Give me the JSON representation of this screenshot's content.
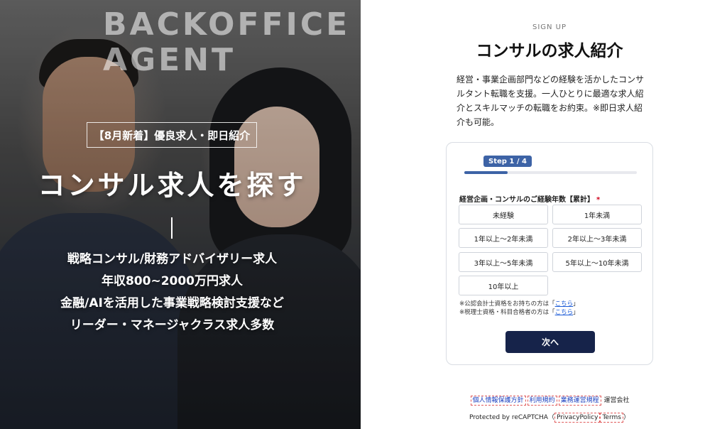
{
  "hero": {
    "brand_line1": "BACKOFFICE",
    "brand_line2": "AGENT",
    "badge": "【8月新着】優良求人・即日紹介",
    "title": "コンサル求人を探す",
    "lines": [
      "戦略コンサル/財務アドバイザリー求人",
      "年収800~2000万円求人",
      "金融/AIを活用した事業戦略検討支援など",
      "リーダー・マネージャクラス求人多数"
    ]
  },
  "signup": {
    "label": "SIGN UP",
    "title": "コンサルの求人紹介",
    "intro": "経営・事業企画部門などの経験を活かしたコンサルタント転職を支援。一人ひとりに最適な求人紹介とスキルマッチの転職をお約束。※即日求人紹介も可能。"
  },
  "form": {
    "step": "Step 1 / 4",
    "progress": 0.25,
    "question": "経営企画・コンサルのご経験年数【累計】",
    "required_mark": "*",
    "options": [
      "未経験",
      "1年未満",
      "1年以上〜2年未満",
      "2年以上〜3年未満",
      "3年以上〜5年未満",
      "5年以上〜10年未満",
      "10年以上"
    ],
    "note1_text": "※公認会計士資格をお持ちの方は「",
    "note1_link": "こちら",
    "note1_end": "」",
    "note2_text": "※税理士資格・科目合格者の方は「",
    "note2_link": "こちら",
    "note2_end": "」",
    "next_label": "次へ"
  },
  "footer": {
    "privacy": "個人情報保護方針",
    "terms": "利用規約",
    "rules": "業務運営規程",
    "operator": "運営会社",
    "recaptcha_prefix": "Protected by reCAPTCHA（",
    "recaptcha_privacy": "PrivacyPolicy",
    "recaptcha_terms": "Terms",
    "recaptcha_suffix": "）"
  },
  "colors": {
    "accent": "#3d63a6",
    "button": "#16234a",
    "link": "#1a5ad7"
  }
}
